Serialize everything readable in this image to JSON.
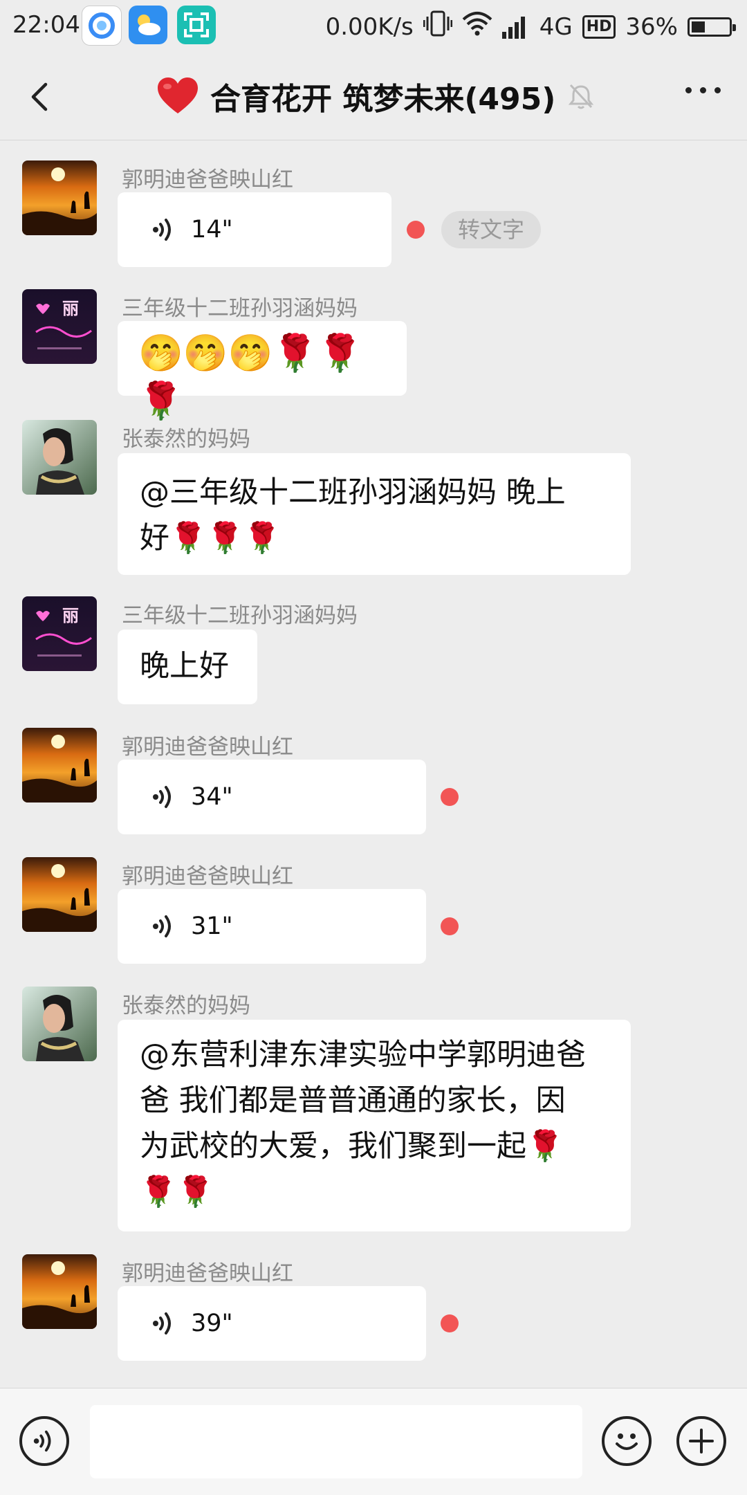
{
  "status_bar": {
    "time": "22:04",
    "network_speed": "0.00K/s",
    "network_type": "4G",
    "hd_label": "HD",
    "battery_percent": "36%",
    "battery_level": 0.36
  },
  "header": {
    "title_emoji": "❤️",
    "title": "合育花开 筑梦未来(495)",
    "icons": [
      "back-icon",
      "mute-bell-icon",
      "more-icon"
    ]
  },
  "messages": [
    {
      "sender": "郭明迪爸爸映山红",
      "type": "voice",
      "duration": "14\"",
      "unread": true,
      "to_text": "转文字"
    },
    {
      "sender": "三年级十二班孙羽涵妈妈",
      "type": "text",
      "text": "🤭🤭🤭🌹🌹🌹"
    },
    {
      "sender": "张泰然的妈妈",
      "type": "text",
      "line1": "@三年级十二班孙羽涵妈妈  晚上",
      "line2": "好🌹🌹🌹"
    },
    {
      "sender": "三年级十二班孙羽涵妈妈",
      "type": "text",
      "text": "晚上好"
    },
    {
      "sender": "郭明迪爸爸映山红",
      "type": "voice",
      "duration": "34\"",
      "unread": true
    },
    {
      "sender": "郭明迪爸爸映山红",
      "type": "voice",
      "duration": "31\"",
      "unread": true
    },
    {
      "sender": "张泰然的妈妈",
      "type": "text",
      "line1": "@东营利津东津实验中学郭明迪爸",
      "line2": "爸  我们都是普普通通的家长，因",
      "line3": "为武校的大爱，我们聚到一起🌹",
      "line4": "🌹🌹"
    },
    {
      "sender": "郭明迪爸爸映山红",
      "type": "voice",
      "duration": "39\"",
      "unread": true
    }
  ],
  "input_bar": {
    "text_value": "",
    "icons": [
      "voice-input-icon",
      "emoji-icon",
      "plus-icon"
    ]
  },
  "colors": {
    "background": "#ededed",
    "bubble": "#ffffff",
    "unread_dot": "#f25555",
    "sender_text": "#8a8a8a"
  }
}
